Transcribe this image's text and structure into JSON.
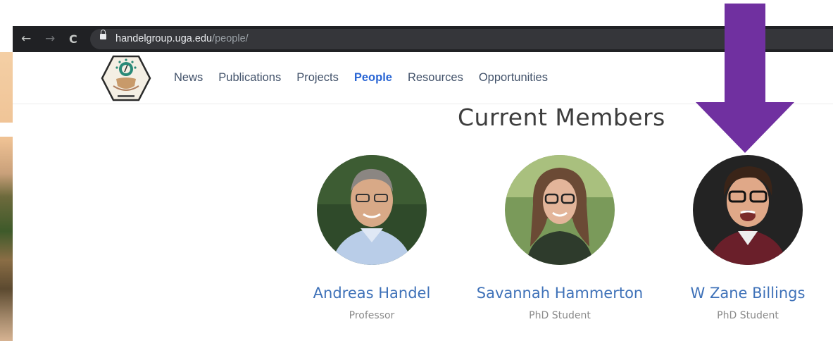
{
  "browser": {
    "back_icon": "←",
    "forward_icon": "→",
    "reload_icon": "C",
    "url_host": "handelgroup.uga.edu",
    "url_path": "/people/"
  },
  "nav": {
    "items": [
      {
        "label": "News",
        "active": false
      },
      {
        "label": "Publications",
        "active": false
      },
      {
        "label": "Projects",
        "active": false
      },
      {
        "label": "People",
        "active": true
      },
      {
        "label": "Resources",
        "active": false
      },
      {
        "label": "Opportunities",
        "active": false
      }
    ]
  },
  "page": {
    "title": "Current Members"
  },
  "members": [
    {
      "name": "Andreas Handel",
      "role": "Professor"
    },
    {
      "name": "Savannah Hammerton",
      "role": "PhD Student"
    },
    {
      "name": "W Zane Billings",
      "role": "PhD Student"
    }
  ],
  "colors": {
    "arrow": "#7030a0",
    "link": "#3e71b8",
    "active_nav": "#2a66d4"
  }
}
